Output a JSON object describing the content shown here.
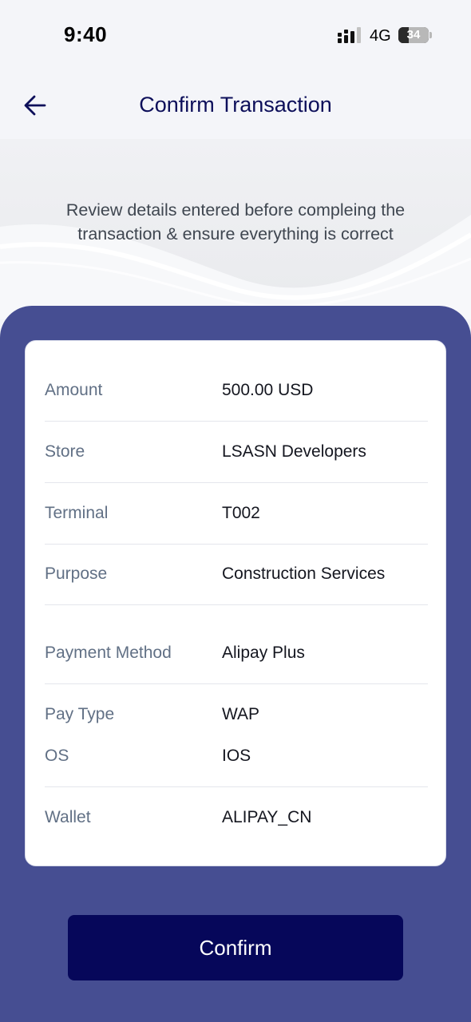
{
  "status_bar": {
    "time": "9:40",
    "network": "4G",
    "battery": "34",
    "battery_level": 0.34,
    "signal_icon": "signal-bars-icon"
  },
  "header": {
    "title": "Confirm Transaction",
    "back_icon": "arrow-left-icon"
  },
  "hero": {
    "description": "Review details entered before compleing the transaction & ensure everything is correct"
  },
  "details": {
    "amount": {
      "label": "Amount",
      "value": "500.00 USD"
    },
    "store": {
      "label": "Store",
      "value": "LSASN Developers"
    },
    "terminal": {
      "label": "Terminal",
      "value": "T002"
    },
    "purpose": {
      "label": "Purpose",
      "value": "Construction Services"
    },
    "payment_method": {
      "label": "Payment Method",
      "value": "Alipay Plus"
    },
    "pay_type": {
      "label": "Pay Type",
      "value": "WAP"
    },
    "os": {
      "label": "OS",
      "value": "IOS"
    },
    "wallet": {
      "label": "Wallet",
      "value": "ALIPAY_CN"
    }
  },
  "actions": {
    "confirm_label": "Confirm"
  },
  "colors": {
    "title": "#0d0f5a",
    "panel": "#464e92",
    "button": "#06075a",
    "label": "#617085",
    "value": "#14161f"
  }
}
